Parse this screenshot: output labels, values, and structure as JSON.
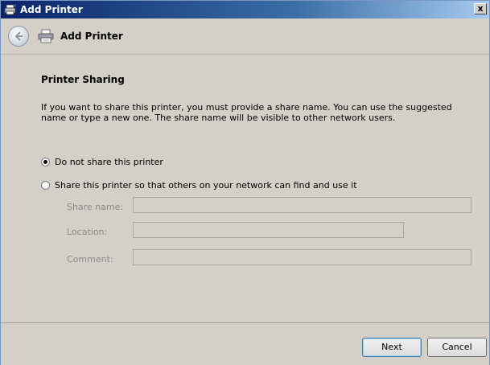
{
  "window": {
    "title": "Add Printer",
    "close_label": "x",
    "title_icon": "printer-wizard-icon"
  },
  "header": {
    "title": "Add Printer",
    "back_icon": "back-arrow-icon",
    "printer_icon": "printer-icon"
  },
  "content": {
    "section_title": "Printer Sharing",
    "description": "If you want to share this printer, you must provide a share name. You can use the suggested name or type a new one. The share name will be visible to other network users.",
    "options": [
      {
        "label": "Do not share this printer",
        "checked": true
      },
      {
        "label": "Share this printer so that others on your network can find and use it",
        "checked": false
      }
    ],
    "fields": {
      "share_name": {
        "label": "Share name:",
        "value": ""
      },
      "location": {
        "label": "Location:",
        "value": ""
      },
      "comment": {
        "label": "Comment:",
        "value": ""
      }
    }
  },
  "footer": {
    "next_label": "Next",
    "cancel_label": "Cancel"
  }
}
